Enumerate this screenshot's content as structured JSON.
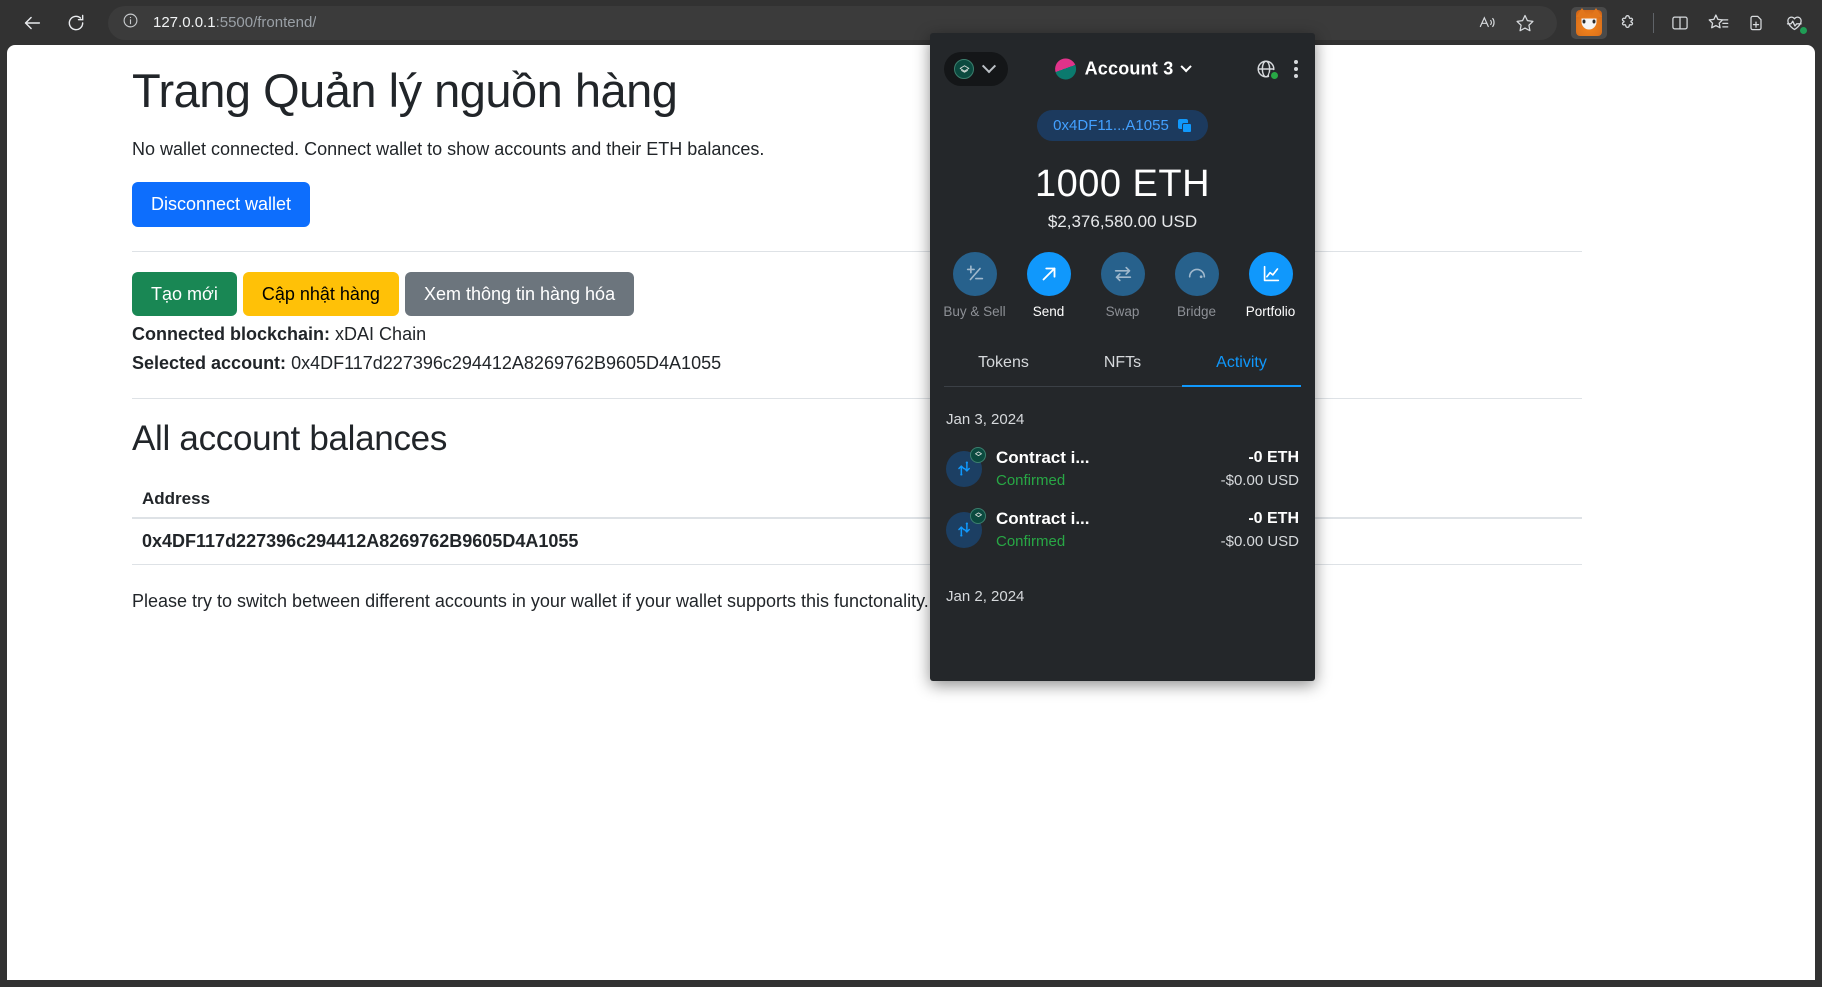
{
  "browser": {
    "back_label": "Back",
    "reload_label": "Refresh",
    "site_info_label": "View site information",
    "url_host": "127.0.0.1",
    "url_path": ":5500/frontend/",
    "read_aloud_label": "Read aloud",
    "favorite_label": "Add this page to favorites",
    "metamask_label": "MetaMask",
    "extensions_label": "Extensions",
    "split_screen_label": "Split screen",
    "collections_label": "Collections",
    "add_tab_label": "Add this page to favorites bar",
    "browser_essentials_label": "Browser essentials"
  },
  "page": {
    "title": "Trang Quản lý nguồn hàng",
    "lead": "No wallet connected. Connect wallet to show accounts and their ETH balances.",
    "disconnect_button": "Disconnect wallet",
    "action_buttons": [
      {
        "label": "Tạo mới",
        "style": "success"
      },
      {
        "label": "Cập nhật hàng",
        "style": "warning"
      },
      {
        "label": "Xem thông tin hàng hóa",
        "style": "secondary"
      }
    ],
    "blockchain_label": "Connected blockchain:",
    "blockchain_value": "xDAI Chain",
    "selected_account_label": "Selected account:",
    "selected_account_value": "0x4DF117d227396c294412A8269762B9605D4A1055",
    "balances_heading": "All account balances",
    "table": {
      "columns": [
        "Address"
      ],
      "rows": [
        [
          "0x4DF117d227396c294412A8269762B9605D4A1055"
        ]
      ]
    },
    "footnote": "Please try to switch between different accounts in your wallet if your wallet supports this functonality."
  },
  "metamask": {
    "network_selector_label": "Network menu",
    "account_name": "Account 3",
    "account_menu_label": "Account options",
    "connection_status_label": "Connected sites",
    "options_menu_label": "Account options menu",
    "address_short": "0x4DF11...A1055",
    "copy_label": "Copy address",
    "balance_eth": "1000 ETH",
    "balance_usd": "$2,376,580.00 USD",
    "actions": [
      {
        "label": "Buy & Sell",
        "icon": "buy-sell-icon",
        "state": "off"
      },
      {
        "label": "Send",
        "icon": "send-icon",
        "state": "on"
      },
      {
        "label": "Swap",
        "icon": "swap-icon",
        "state": "off"
      },
      {
        "label": "Bridge",
        "icon": "bridge-icon",
        "state": "off"
      },
      {
        "label": "Portfolio",
        "icon": "portfolio-icon",
        "state": "on"
      }
    ],
    "tabs": [
      {
        "label": "Tokens",
        "active": false
      },
      {
        "label": "NFTs",
        "active": false
      },
      {
        "label": "Activity",
        "active": true
      }
    ],
    "activity": [
      {
        "date": "Jan 3, 2024",
        "items": [
          {
            "title": "Contract i...",
            "status": "Confirmed",
            "amount": "-0 ETH",
            "fiat": "-$0.00 USD"
          },
          {
            "title": "Contract i...",
            "status": "Confirmed",
            "amount": "-0 ETH",
            "fiat": "-$0.00 USD"
          }
        ]
      },
      {
        "date": "Jan 2, 2024",
        "items": []
      }
    ]
  },
  "colors": {
    "accent_blue": "#0d6efd",
    "mm_blue": "#1098fc",
    "success_green": "#198754",
    "warning_yellow": "#ffc107",
    "secondary_gray": "#6c757d",
    "mm_bg": "#24272a",
    "status_green": "#28a745"
  }
}
